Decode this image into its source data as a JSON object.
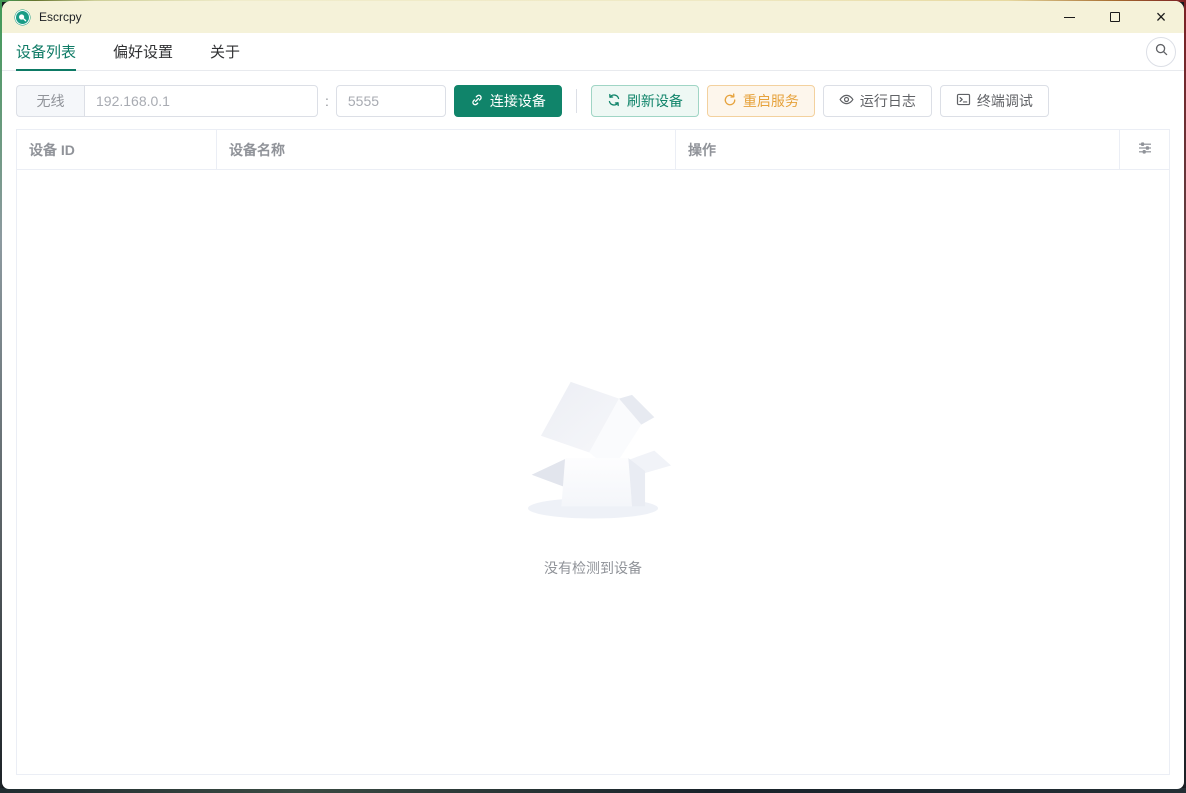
{
  "window": {
    "title": "Escrcpy",
    "controls": {
      "close_glyph": "×"
    }
  },
  "tabs": [
    {
      "label": "设备列表",
      "active": true
    },
    {
      "label": "偏好设置",
      "active": false
    },
    {
      "label": "关于",
      "active": false
    }
  ],
  "toolbar": {
    "wireless_label": "无线",
    "ip_placeholder": "192.168.0.1",
    "port_separator": ":",
    "port_placeholder": "5555",
    "connect_label": "连接设备",
    "refresh_label": "刷新设备",
    "restart_label": "重启服务",
    "logs_label": "运行日志",
    "terminal_label": "终端调试"
  },
  "table": {
    "columns": [
      "设备 ID",
      "设备名称",
      "操作"
    ],
    "rows": [],
    "empty_text": "没有检测到设备"
  },
  "colors": {
    "primary_green": "#10846a",
    "warning_orange": "#e6a23c",
    "titlebar_cream": "#f5f2d9",
    "muted_text": "#909399",
    "table_border": "#ebeef5"
  },
  "icons": {
    "app": "escrcpy-logo",
    "minimize": "minimize-line",
    "maximize": "maximize-square",
    "close": "close-x",
    "search": "magnifier",
    "connect": "link",
    "refresh": "circular-arrows",
    "restart": "c-arrow",
    "logs": "eye",
    "terminal": "monitor-prompt",
    "table_settings": "sliders",
    "empty_state": "open-box-illustration"
  }
}
